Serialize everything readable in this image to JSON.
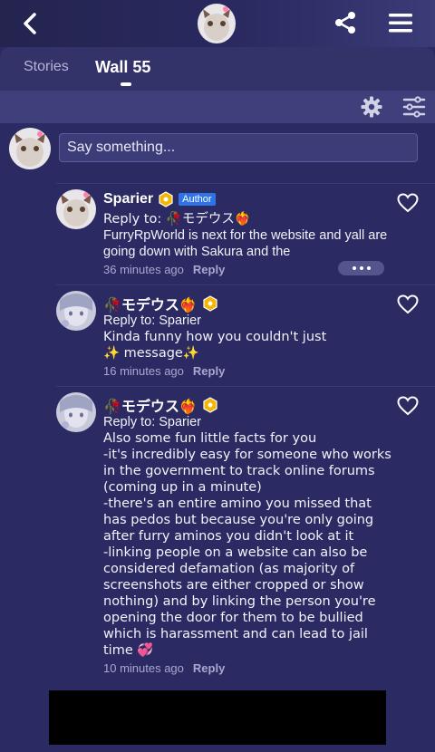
{
  "header": {
    "back_icon": "chevron-left-icon",
    "share_icon": "share-icon",
    "menu_icon": "hamburger-menu-icon"
  },
  "tabs": [
    {
      "label": "Stories",
      "active": false
    },
    {
      "label": "Wall 55",
      "active": true
    }
  ],
  "toolbar": {
    "settings_icon": "gear-icon",
    "filter_icon": "sliders-icon"
  },
  "compose": {
    "placeholder": "Say something..."
  },
  "comments": [
    {
      "name": "Sparier",
      "author_tag": "Author",
      "reply_to": "Reply to: 🥀モデウス❤️‍🔥",
      "text": "FurryRpWorld is next for the website and yall are going down with Sakura and the",
      "time": "36 minutes ago",
      "reply_label": "Reply"
    },
    {
      "name": "🥀モデウス❤️‍🔥",
      "reply_to": "Reply to: Sparier",
      "text": "Kinda funny how you couldn't just\n✨ message✨",
      "time": "16 minutes ago",
      "reply_label": "Reply"
    },
    {
      "name": "🥀モデウス❤️‍🔥",
      "reply_to": "Reply to: Sparier",
      "text": "Also some fun little facts for you\n-it's incredibly easy for someone who works in the government to track online forums (coming up in a minute)\n-there's an entire amino you missed that has pedos but because you're only going after furry aminos you didn't look at it\n-linking people on a website can also be considered defamation (as majority of screenshots are either cropped or show nothing) and by linking the person you're opening the door for them to be bullied which is harassment and can lead to jail time 💞",
      "time": "10 minutes ago",
      "reply_label": "Reply"
    }
  ],
  "colors": {
    "background": "#2b2a63",
    "author_tag": "#2e74e6",
    "level_badge": "#f2b705"
  }
}
